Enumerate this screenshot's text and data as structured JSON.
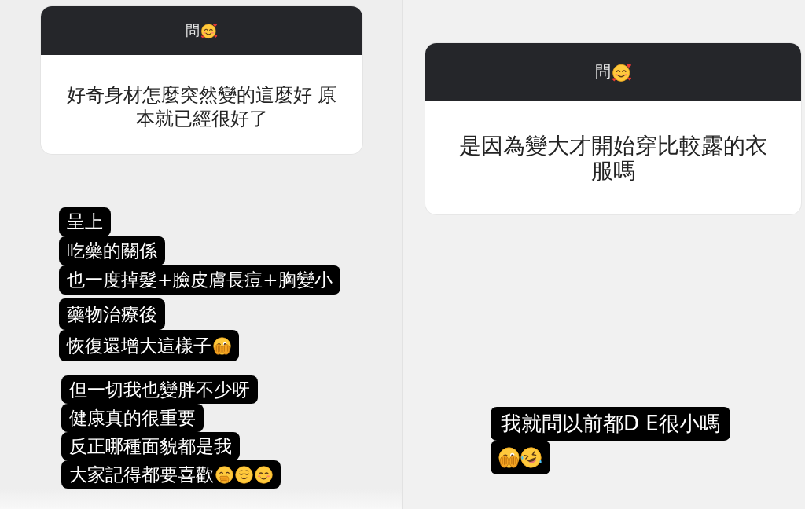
{
  "panels": [
    {
      "question_card": {
        "header_label": "問",
        "question": "好奇身材怎麼突然變的這麼好 原本就已經很好了"
      },
      "answer_blocks": [
        {
          "lines": [
            "呈上",
            "吃藥的關係",
            "也一度掉髮+臉皮膚長痘+胸變小"
          ]
        },
        {
          "lines": [
            "藥物治療後",
            "恢復還增大這樣子"
          ]
        },
        {
          "lines": [
            "但一切我也變胖不少呀",
            "健康真的很重要",
            "反正哪種面貌都是我",
            "大家記得都要喜歡"
          ]
        }
      ]
    },
    {
      "question_card": {
        "header_label": "問",
        "question": "是因為變大才開始穿比較露的衣服嗎"
      },
      "answer_blocks": [
        {
          "lines": [
            "我就問以前都D E很小嗎"
          ]
        }
      ]
    }
  ]
}
